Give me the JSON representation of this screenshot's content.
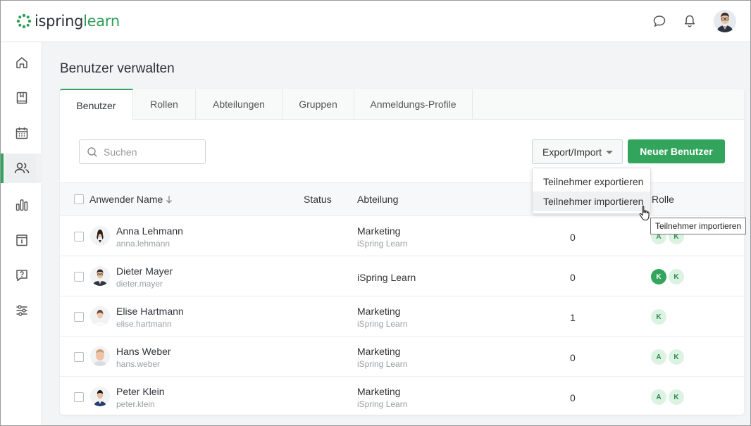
{
  "brand": {
    "logo_word1": "ispring",
    "logo_word2": "learn",
    "green": "#2fa65b"
  },
  "header": {
    "icons": [
      "chat-bubble-icon",
      "bell-icon"
    ],
    "avatar": "user-avatar"
  },
  "sidebar": {
    "items": [
      {
        "icon": "home-icon",
        "active": false
      },
      {
        "icon": "book-icon",
        "active": false
      },
      {
        "icon": "calendar-icon",
        "active": false
      },
      {
        "icon": "users-icon",
        "active": true
      },
      {
        "icon": "bar-chart-icon",
        "active": false
      },
      {
        "icon": "info-box-icon",
        "active": false
      },
      {
        "icon": "question-bubble-icon",
        "active": false
      },
      {
        "icon": "sliders-icon",
        "active": false
      }
    ]
  },
  "page": {
    "title": "Benutzer verwalten"
  },
  "tabs": [
    {
      "label": "Benutzer",
      "active": true
    },
    {
      "label": "Rollen",
      "active": false
    },
    {
      "label": "Abteilungen",
      "active": false
    },
    {
      "label": "Gruppen",
      "active": false
    },
    {
      "label": "Anmeldungs-Profile",
      "active": false
    }
  ],
  "toolbar": {
    "search_placeholder": "Suchen",
    "export_import_label": "Export/Import",
    "new_user_label": "Neuer Benutzer"
  },
  "dropdown": {
    "items": [
      "Teilnehmer exportieren",
      "Teilnehmer importieren"
    ],
    "hovered_index": 1
  },
  "tooltip": "Teilnehmer importieren",
  "table": {
    "columns": {
      "name": "Anwender Name",
      "status": "Status",
      "department": "Abteilung",
      "role": "Rolle"
    },
    "rows": [
      {
        "name": "Anna Lehmann",
        "login": "anna.lehmann",
        "department": "Marketing",
        "sub": "iSpring Learn",
        "count": "0",
        "roles": [
          {
            "letter": "A",
            "solid": false
          },
          {
            "letter": "K",
            "solid": false
          }
        ]
      },
      {
        "name": "Dieter Mayer",
        "login": "dieter.mayer",
        "department": "iSpring Learn",
        "sub": "",
        "count": "0",
        "roles": [
          {
            "letter": "K",
            "solid": true
          },
          {
            "letter": "K",
            "solid": false
          }
        ]
      },
      {
        "name": "Elise Hartmann",
        "login": "elise.hartmann",
        "department": "Marketing",
        "sub": "iSpring Learn",
        "count": "1",
        "roles": [
          {
            "letter": "K",
            "solid": false
          }
        ]
      },
      {
        "name": "Hans Weber",
        "login": "hans.weber",
        "department": "Marketing",
        "sub": "iSpring Learn",
        "count": "0",
        "roles": [
          {
            "letter": "A",
            "solid": false
          },
          {
            "letter": "K",
            "solid": false
          }
        ]
      },
      {
        "name": "Peter Klein",
        "login": "peter.klein",
        "department": "Marketing",
        "sub": "iSpring Learn",
        "count": "0",
        "roles": [
          {
            "letter": "A",
            "solid": false
          },
          {
            "letter": "K",
            "solid": false
          }
        ]
      }
    ]
  }
}
